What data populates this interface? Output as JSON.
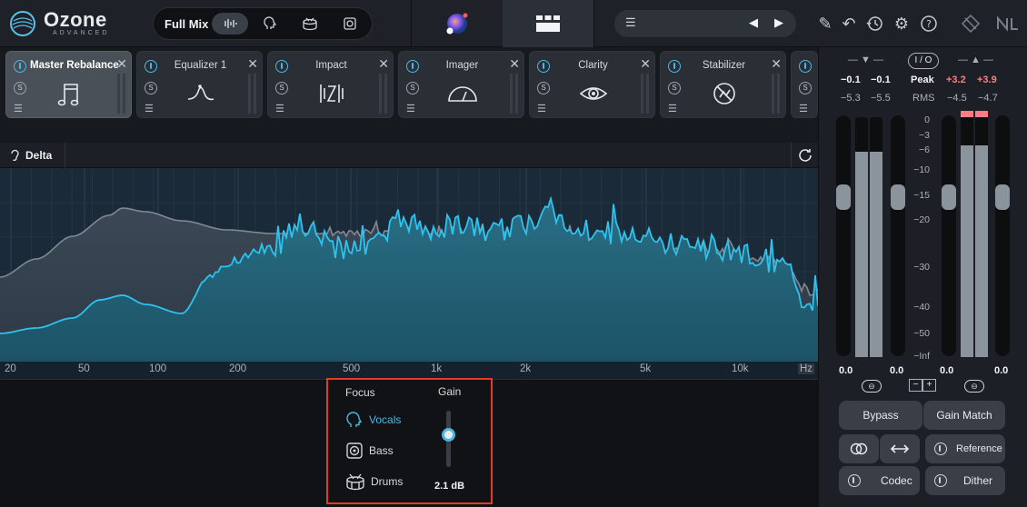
{
  "app": {
    "name": "Ozone",
    "edition": "ADVANCED"
  },
  "header": {
    "mix_label": "Full Mix"
  },
  "modules": [
    {
      "name": "Master Rebalance",
      "active": true
    },
    {
      "name": "Equalizer 1",
      "active": false
    },
    {
      "name": "Impact",
      "active": false
    },
    {
      "name": "Imager",
      "active": false
    },
    {
      "name": "Clarity",
      "active": false
    },
    {
      "name": "Stabilizer",
      "active": false
    }
  ],
  "delta": {
    "label": "Delta"
  },
  "spectrum": {
    "freq_labels": [
      "20",
      "50",
      "100",
      "200",
      "500",
      "1k",
      "2k",
      "5k",
      "10k"
    ],
    "unit": "Hz",
    "colors": {
      "fill": "#1f5f73",
      "line": "#2ec2ee",
      "reference": "#7f8993",
      "background": "#1a2a38"
    }
  },
  "focus_panel": {
    "focus_title": "Focus",
    "gain_title": "Gain",
    "items": [
      {
        "label": "Vocals",
        "icon": "head-icon",
        "selected": true
      },
      {
        "label": "Bass",
        "icon": "speaker-icon",
        "selected": false
      },
      {
        "label": "Drums",
        "icon": "drum-icon",
        "selected": false
      }
    ],
    "gain_value": "2.1 dB",
    "highlight_color": "#e53a27"
  },
  "meters": {
    "in_peak": [
      "−0.1",
      "−0.1"
    ],
    "in_rms": [
      "−5.3",
      "−5.5"
    ],
    "io_label": "I / O",
    "peak_label": "Peak",
    "rms_label": "RMS",
    "out_peak": [
      "+3.2",
      "+3.9"
    ],
    "out_rms": [
      "−4.5",
      "−4.7"
    ],
    "scale": [
      "0",
      "−3",
      "−6",
      "−10",
      "−15",
      "−20",
      "−30",
      "−40",
      "−50",
      "−Inf"
    ],
    "in_gain": [
      "0.0",
      "0.0"
    ],
    "out_gain": [
      "0.0",
      "0.0"
    ],
    "link_labels": [
      "−",
      "+"
    ]
  },
  "buttons": {
    "bypass": "Bypass",
    "gain_match": "Gain Match",
    "reference": "Reference",
    "codec": "Codec",
    "dither": "Dither"
  }
}
